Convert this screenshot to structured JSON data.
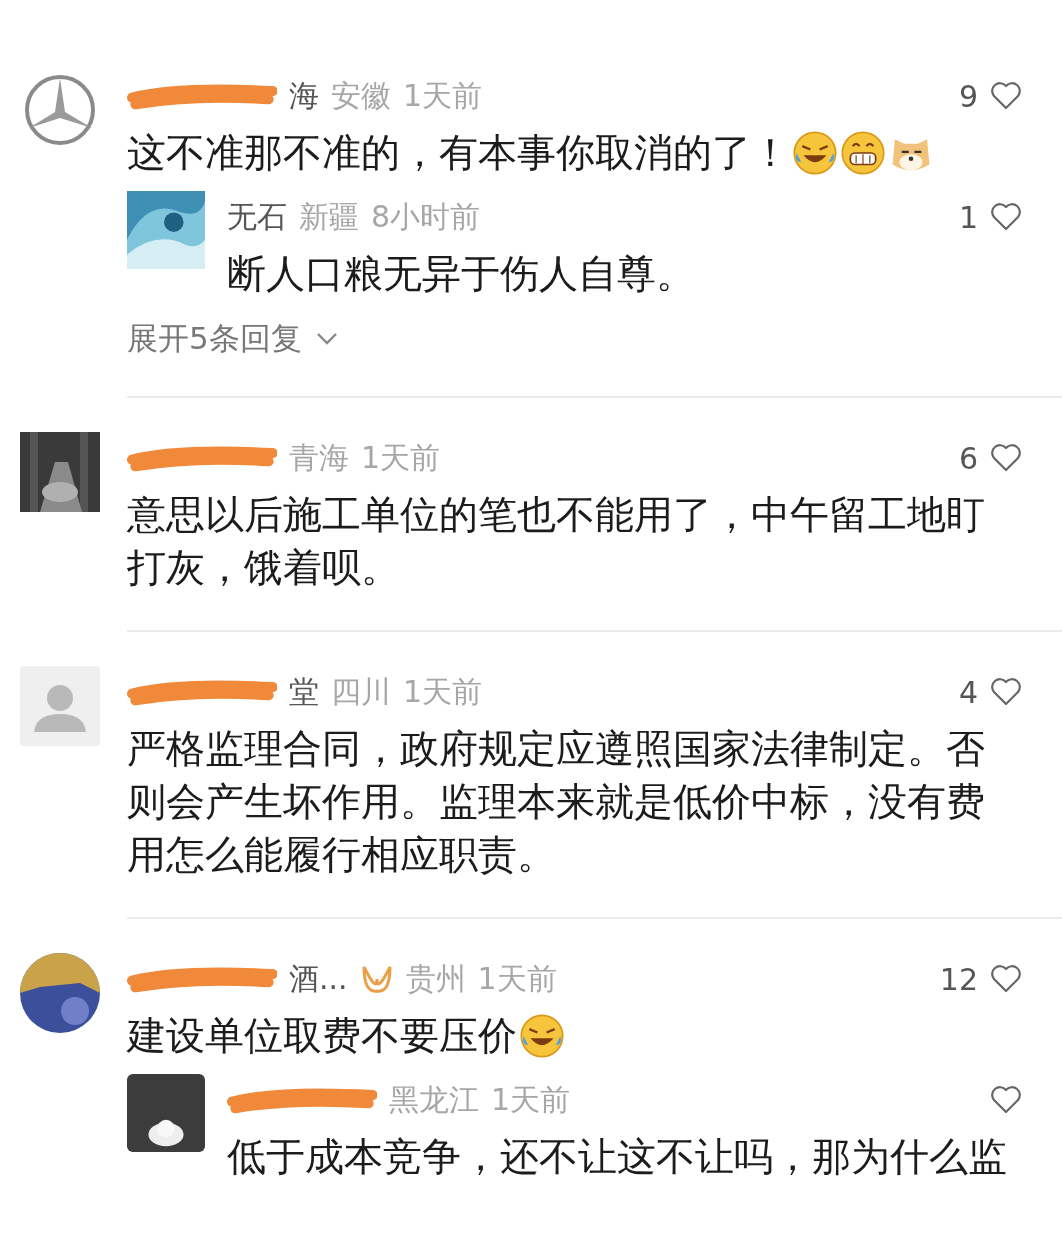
{
  "comments": [
    {
      "avatar": {
        "kind": "emblem"
      },
      "redacted": true,
      "name": "海",
      "badge": false,
      "region": "安徽",
      "time": "1天前",
      "likes": "9",
      "text": "这不准那不准的，有本事你取消的了！",
      "emoji": [
        {
          "kind": "laugh-cry"
        },
        {
          "kind": "grin"
        },
        {
          "kind": "doge"
        }
      ],
      "replies": [
        {
          "avatar": {
            "kind": "wave"
          },
          "redacted": false,
          "name": "无石",
          "region": "新疆",
          "time": "8小时前",
          "likes": "1",
          "text": "断人口粮无异于伤人自尊。"
        }
      ],
      "expand": "展开5条回复"
    },
    {
      "redacted": true,
      "badge": false,
      "region": "青海",
      "time": "1天前",
      "likes": "6",
      "text": "意思以后施工单位的笔也不能用了，中午留工地盯打灰，饿着呗。"
    },
    {
      "avatar": {
        "kind": "default"
      },
      "redacted": true,
      "name": "堂",
      "badge": false,
      "region": "四川",
      "time": "1天前",
      "likes": "4",
      "text": "严格监理合同，政府规定应遵照国家法律制定。否则会产生坏作用。监理本来就是低价中标，没有费用怎么能履行相应职责。"
    },
    {
      "avatar": {
        "kind": "round"
      },
      "redacted": true,
      "name": "酒...",
      "badge": true,
      "region": "贵州",
      "time": "1天前",
      "likes": "12",
      "text": "建设单位取费不要压价",
      "emoji": [
        {
          "kind": "laugh-cry"
        }
      ],
      "replies": [
        {
          "avatar": {
            "kind": "dark"
          },
          "redacted": true,
          "region": "黑龙江",
          "time": "1天前",
          "text": "低于成本竞争，还不让这不让吗，那为什么监"
        }
      ]
    }
  ]
}
